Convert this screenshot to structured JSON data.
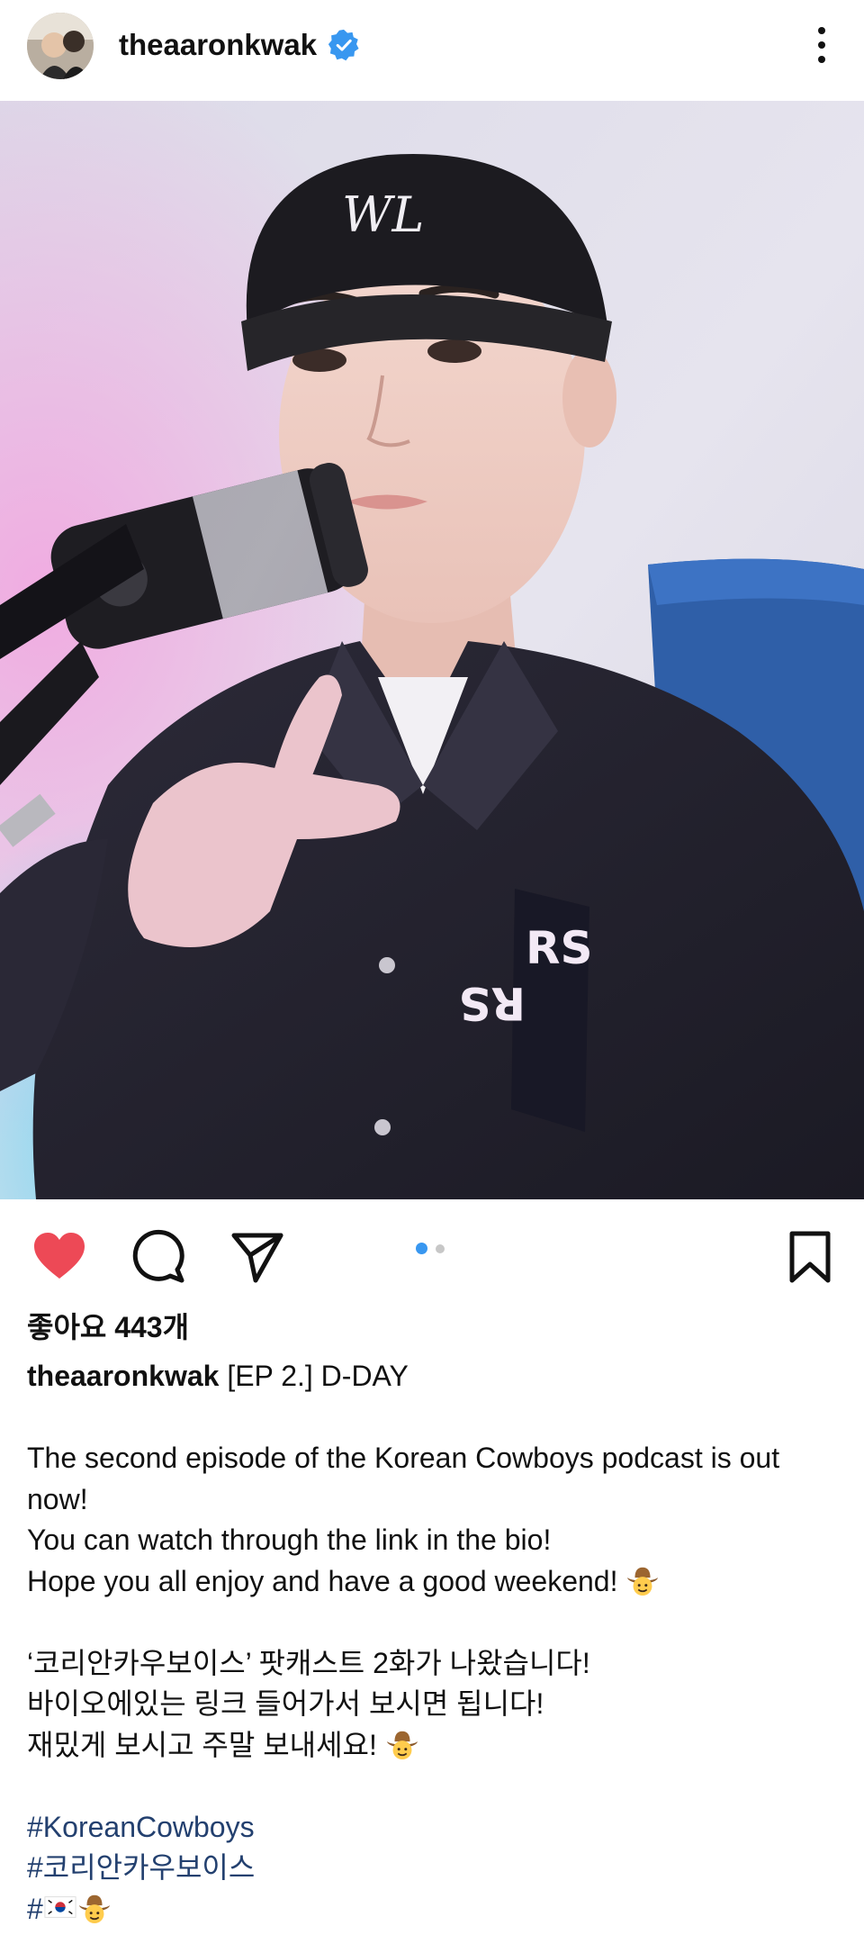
{
  "header": {
    "username": "theaaronkwak",
    "verified_icon": "verified-badge-icon",
    "more_icon": "more-vertical-icon"
  },
  "post": {
    "image_description_icon": "post-photo",
    "carousel": {
      "current": 1,
      "total": 2
    }
  },
  "actions": {
    "like_icon": "heart-filled-icon",
    "comment_icon": "comment-icon",
    "share_icon": "send-icon",
    "save_icon": "bookmark-icon"
  },
  "likes_text": "좋아요 443개",
  "caption": {
    "username": "theaaronkwak",
    "title": "[EP 2.] D-DAY",
    "en_line1": "The second episode of the Korean Cowboys podcast is out now!",
    "en_line2": "You can watch through the link in the bio!",
    "en_line3": "Hope you all enjoy and have a good weekend!",
    "ko_line1": "‘코리안카우보이스’ 팟캐스트 2화가 나왔습니다!",
    "ko_line2": "바이오에있는 링크 들어가서 보시면 됩니다!",
    "ko_line3": "재밌게 보시고 주말 보내세요!",
    "hashtag1": "#KoreanCowboys",
    "hashtag2": "#코리안카우보이스",
    "hashtag3_prefix": "#"
  },
  "colors": {
    "like_red": "#ed4956",
    "verified_blue": "#3897f0",
    "hashtag_blue": "#23406f",
    "active_dot": "#3897f0",
    "inactive_dot": "#c7c7c7"
  }
}
